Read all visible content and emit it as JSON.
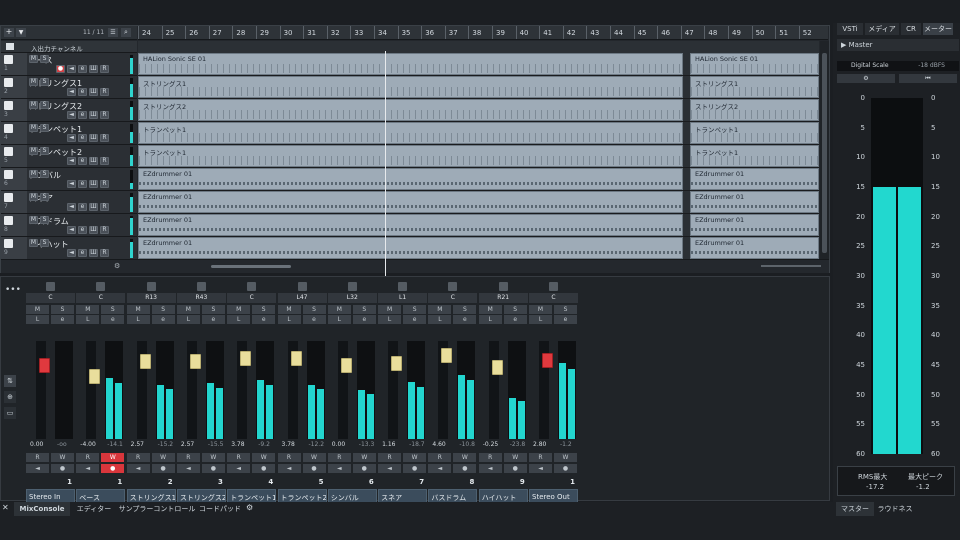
{
  "project": {
    "counter": "11 / 11",
    "input_output_channels": "入出力チャンネル",
    "ruler": [
      "24",
      "25",
      "26",
      "27",
      "28",
      "29",
      "30",
      "31",
      "32",
      "33",
      "34",
      "35",
      "36",
      "37",
      "38",
      "39",
      "40",
      "41",
      "42",
      "43",
      "44",
      "45",
      "46",
      "47",
      "48",
      "49",
      "50",
      "51",
      "52"
    ],
    "tracks": [
      {
        "num": "1",
        "name": "ベース",
        "buttons": [
          "M",
          "S"
        ],
        "controls": [
          "●",
          "◄",
          "e",
          "Ш",
          "R"
        ],
        "events": [
          {
            "label": "HALion Sonic SE 01"
          },
          {
            "label": "HALion Sonic SE 01"
          }
        ],
        "level": 0.85
      },
      {
        "num": "2",
        "name": "ストリングス1",
        "buttons": [
          "M",
          "S"
        ],
        "controls": [
          "◄",
          "e",
          "Ш",
          "R"
        ],
        "events": [
          {
            "label": "ストリングス1"
          },
          {
            "label": "ストリングス1"
          }
        ],
        "level": 0.7
      },
      {
        "num": "3",
        "name": "ストリングス2",
        "buttons": [
          "M",
          "S"
        ],
        "controls": [
          "◄",
          "e",
          "Ш",
          "R"
        ],
        "events": [
          {
            "label": "ストリングス2"
          },
          {
            "label": "ストリングス2"
          }
        ],
        "level": 0.7
      },
      {
        "num": "4",
        "name": "トランペット1",
        "buttons": [
          "M",
          "S"
        ],
        "controls": [
          "◄",
          "e",
          "Ш",
          "R"
        ],
        "events": [
          {
            "label": "トランペット1"
          },
          {
            "label": "トランペット1"
          }
        ],
        "level": 0.6
      },
      {
        "num": "5",
        "name": "トランペット2",
        "buttons": [
          "M",
          "S"
        ],
        "controls": [
          "◄",
          "e",
          "Ш",
          "R"
        ],
        "events": [
          {
            "label": "トランペット1"
          },
          {
            "label": "トランペット1"
          }
        ],
        "level": 0.6
      },
      {
        "num": "6",
        "name": "シンバル",
        "buttons": [
          "M",
          "S"
        ],
        "controls": [
          "◄",
          "e",
          "Ш",
          "R"
        ],
        "events": [
          {
            "label": "EZdrummer 01"
          },
          {
            "label": "EZdrummer 01"
          }
        ],
        "level": 0.3
      },
      {
        "num": "7",
        "name": "スネア",
        "buttons": [
          "M",
          "S"
        ],
        "controls": [
          "◄",
          "e",
          "Ш",
          "R"
        ],
        "events": [
          {
            "label": "EZdrummer 01"
          },
          {
            "label": "EZdrummer 01"
          }
        ],
        "level": 0.8
      },
      {
        "num": "8",
        "name": "バスドラム",
        "buttons": [
          "M",
          "S"
        ],
        "controls": [
          "◄",
          "e",
          "Ш",
          "R"
        ],
        "events": [
          {
            "label": "EZdrummer 01"
          },
          {
            "label": "EZdrummer 01"
          }
        ],
        "level": 0.9
      },
      {
        "num": "9",
        "name": "ハイハット",
        "buttons": [
          "M",
          "S"
        ],
        "controls": [
          "◄",
          "e",
          "Ш",
          "R"
        ],
        "events": [
          {
            "label": "EZdrummer 01"
          },
          {
            "label": "EZdrummer 01"
          }
        ],
        "level": 0.85
      }
    ]
  },
  "mixer": {
    "channels": [
      {
        "name": "Stereo In",
        "num": "1",
        "pan": "C",
        "fader": "0.00",
        "peak": "-oo",
        "level": 0,
        "fader_level": 0.78,
        "red": true
      },
      {
        "name": "ベース",
        "num": "1",
        "pan": "C",
        "fader": "-4.00",
        "peak": "-14.1",
        "level": 0.62,
        "fader_level": 0.66,
        "rec": true
      },
      {
        "name": "ストリングス1",
        "num": "2",
        "pan": "R13",
        "fader": "2.57",
        "peak": "-15.2",
        "level": 0.55,
        "fader_level": 0.82
      },
      {
        "name": "ストリングス2",
        "num": "3",
        "pan": "R43",
        "fader": "2.57",
        "peak": "-15.5",
        "level": 0.57,
        "fader_level": 0.82
      },
      {
        "name": "トランペット1",
        "num": "4",
        "pan": "C",
        "fader": "3.78",
        "peak": "-9.2",
        "level": 0.6,
        "fader_level": 0.85
      },
      {
        "name": "トランペット2",
        "num": "5",
        "pan": "L47",
        "fader": "3.78",
        "peak": "-12.2",
        "level": 0.55,
        "fader_level": 0.85
      },
      {
        "name": "シンバル",
        "num": "6",
        "pan": "L32",
        "fader": "0.00",
        "peak": "-13.3",
        "level": 0.5,
        "fader_level": 0.78
      },
      {
        "name": "スネア",
        "num": "7",
        "pan": "L1",
        "fader": "1.16",
        "peak": "-18.7",
        "level": 0.58,
        "fader_level": 0.8
      },
      {
        "name": "バスドラム",
        "num": "8",
        "pan": "C",
        "fader": "4.60",
        "peak": "-10.8",
        "level": 0.65,
        "fader_level": 0.88
      },
      {
        "name": "ハイハット",
        "num": "9",
        "pan": "R21",
        "fader": "-0.25",
        "peak": "-23.8",
        "level": 0.42,
        "fader_level": 0.76
      },
      {
        "name": "Stereo Out",
        "num": "1",
        "pan": "C",
        "fader": "2.80",
        "peak": "-1.2",
        "level": 0.78,
        "fader_level": 0.83,
        "red": true
      }
    ],
    "rw": [
      "R",
      "W"
    ]
  },
  "right": {
    "tabs": [
      "VSTi",
      "メディア",
      "CR",
      "メーター"
    ],
    "master": "Master",
    "digital_scale": "Digital Scale",
    "scale_value": "-18 dBFS",
    "scale_left": [
      "0",
      "5",
      "10",
      "15",
      "20",
      "25",
      "30",
      "35",
      "40",
      "45",
      "50",
      "55",
      "60"
    ],
    "scale_right": [
      "0",
      "5",
      "10",
      "15",
      "20",
      "25",
      "30",
      "35",
      "40",
      "45",
      "50",
      "55",
      "60"
    ],
    "rms_label": "RMS最大",
    "rms_value": "-17.2",
    "peak_label": "最大ピーク",
    "peak_value": "-1.2",
    "meter_level": 0.75,
    "bottom_tabs": [
      "マスター",
      "ラウドネス"
    ]
  },
  "bottom_tabs": [
    "MixConsole",
    "エディター",
    "サンプラーコントロール",
    "コードパッド"
  ]
}
